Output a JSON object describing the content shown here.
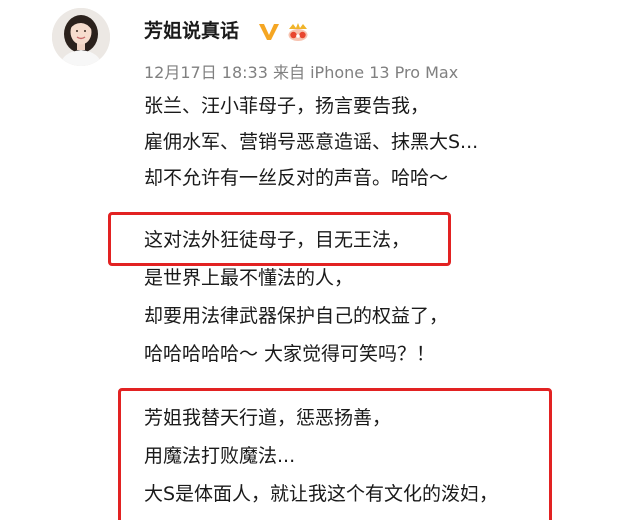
{
  "post": {
    "username": "芳姐说真话",
    "verified_badge_icon": "verified-v-icon",
    "vip_badge_icon": "crown-badge-icon",
    "timestamp": "12月17日 18:33",
    "source": "来自 iPhone 13 Pro Max",
    "paragraphs": [
      {
        "lines": [
          "张兰、汪小菲母子，扬言要告我，",
          "雇佣水军、营销号恶意造谣、抹黑大S...",
          "却不允许有一丝反对的声音。哈哈～"
        ]
      },
      {
        "lines": [
          "这对法外狂徒母子，目无王法，",
          "是世界上最不懂法的人，",
          "却要用法律武器保护自己的权益了，",
          "哈哈哈哈哈～ 大家觉得可笑吗？！"
        ]
      },
      {
        "lines": [
          "芳姐我替天行道，惩恶扬善，",
          "用魔法打败魔法...",
          "大S是体面人，就让我这个有文化的泼妇，"
        ]
      }
    ]
  },
  "colors": {
    "highlight": "#e22222",
    "verified": "#f5a623",
    "meta_text": "#808080"
  }
}
